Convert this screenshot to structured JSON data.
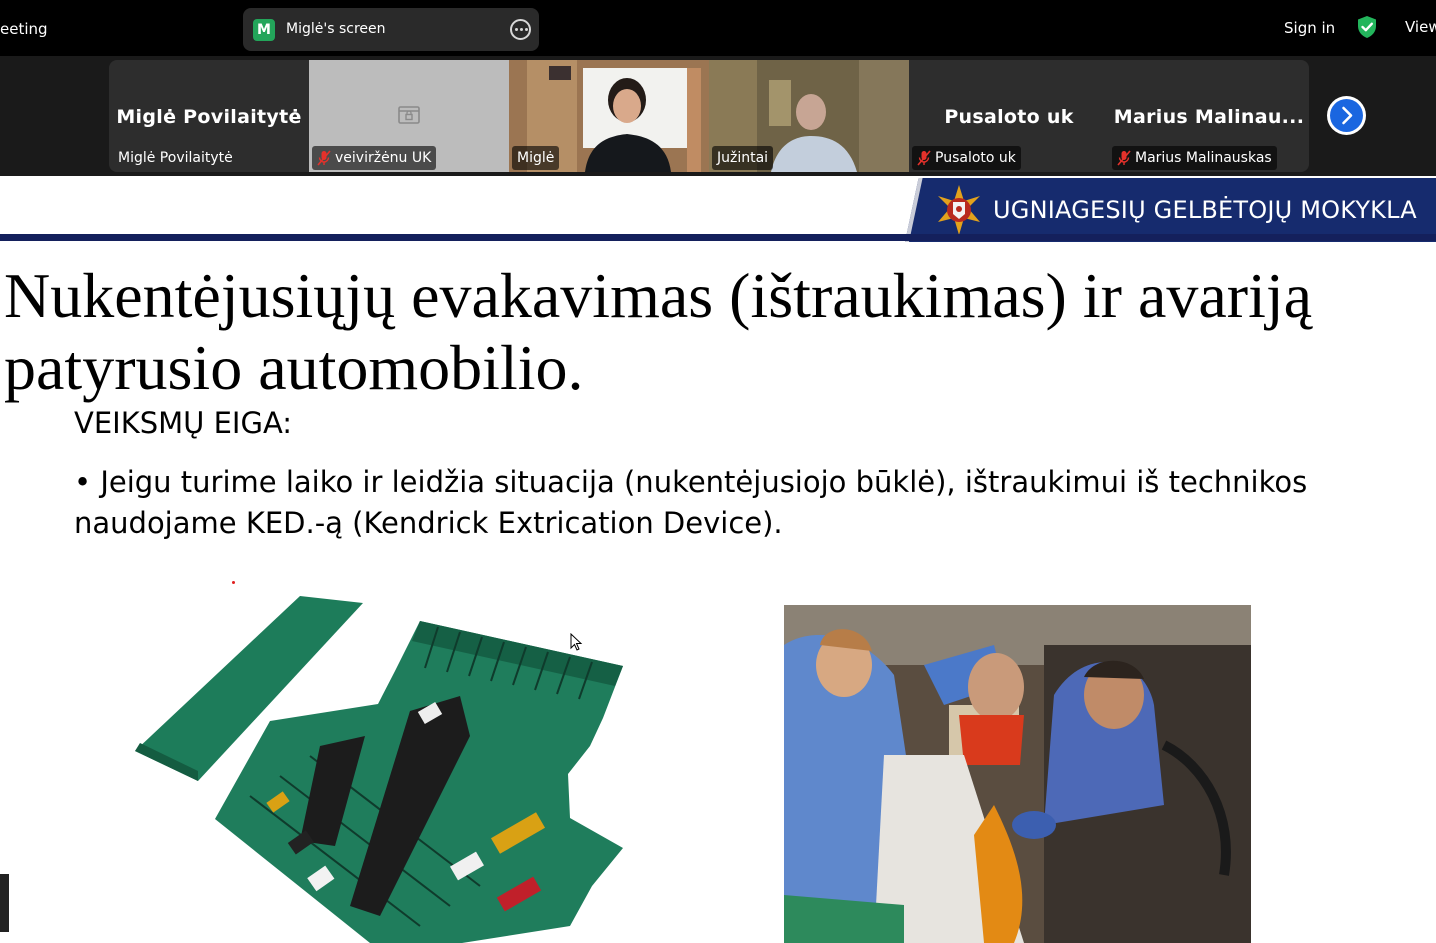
{
  "topbar": {
    "meeting_label": "eeting",
    "share": {
      "avatar_letter": "M",
      "label": "Miglė's screen"
    },
    "sign_in": "Sign in",
    "view": "View"
  },
  "gallery": {
    "tiles": [
      {
        "big_name": "Miglė Povilaitytė",
        "tag": "Miglė Povilaitytė",
        "muted": false,
        "video": false
      },
      {
        "big_name": "",
        "tag": "veiviržėnu UK",
        "muted": true,
        "video": false
      },
      {
        "big_name": "",
        "tag": "Miglė",
        "muted": false,
        "video": true,
        "active": true
      },
      {
        "big_name": "",
        "tag": "Južintai",
        "muted": false,
        "video": true
      },
      {
        "big_name": "Pusaloto uk",
        "tag": "Pusaloto uk",
        "muted": true,
        "video": false
      },
      {
        "big_name": "Marius  Malinau...",
        "tag": "Marius Malinauskas",
        "muted": true,
        "video": false
      }
    ]
  },
  "slide": {
    "brand": "UGNIAGESIŲ GELBĖTOJŲ MOKYKLA",
    "title_line1": "Nukentėjusiųjų evakavimas (ištraukimas) ir avariją",
    "title_line2": "patyrusio automobilio.",
    "subtitle": "VEIKSMŲ EIGA:",
    "bullet": "• Jeigu turime laiko ir leidžia situacija (nukentėjusiojo būklė), ištraukimui iš technikos naudojame KED.-ą (Kendrick Extrication Device)."
  },
  "colors": {
    "active_outline": "#2ecf6b",
    "brand_bg": "#162b6e",
    "rule": "#14205c",
    "ked_green": "#1e7a5a",
    "next_button": "#1a66e0"
  }
}
